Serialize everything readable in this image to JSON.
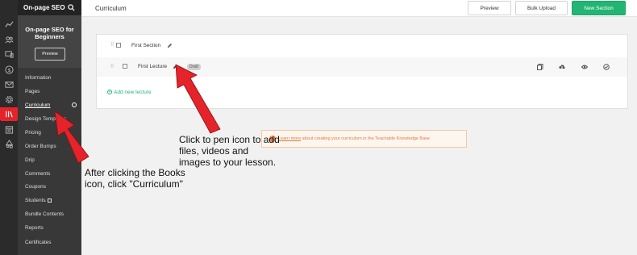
{
  "sidebar": {
    "brand": "On-page SEO",
    "course_title": "On-page SEO for Beginners",
    "preview_label": "Preview",
    "nav": [
      "Information",
      "Pages",
      "Curriculum",
      "Design Templates",
      "Pricing",
      "Order Bumps",
      "Drip",
      "Comments",
      "Coupons",
      "Students",
      "Bundle Contents",
      "Reports",
      "Certificates"
    ],
    "active_item": "Curriculum"
  },
  "rail": {
    "icons": [
      "trend-icon",
      "users-icon",
      "devices-icon",
      "dollar-icon",
      "mail-icon",
      "gear-icon",
      "books-icon",
      "calendar-icon",
      "shapes-icon"
    ],
    "active_icon": "books-icon"
  },
  "header": {
    "title": "Curriculum",
    "preview_label": "Preview",
    "bulk_upload_label": "Bulk Upload",
    "new_section_label": "New Section"
  },
  "curriculum": {
    "section_title": "First Section",
    "lecture_title": "First Lecture",
    "lecture_status": "Draft",
    "add_lecture_label": "Add new lecture"
  },
  "banner": {
    "link_text": "Learn more",
    "text": " about creating your curriculum in the Teachable Knowledge Base"
  },
  "annotations": {
    "pen_note": [
      "Click to pen icon to add",
      "files, videos and",
      "images to your lesson."
    ],
    "books_note": [
      "After clicking the Books",
      "icon, click \"Curriculum\""
    ]
  },
  "colors": {
    "accent_green": "#22b573",
    "annotation_red": "#e5232a",
    "banner_orange": "#e47a44"
  }
}
